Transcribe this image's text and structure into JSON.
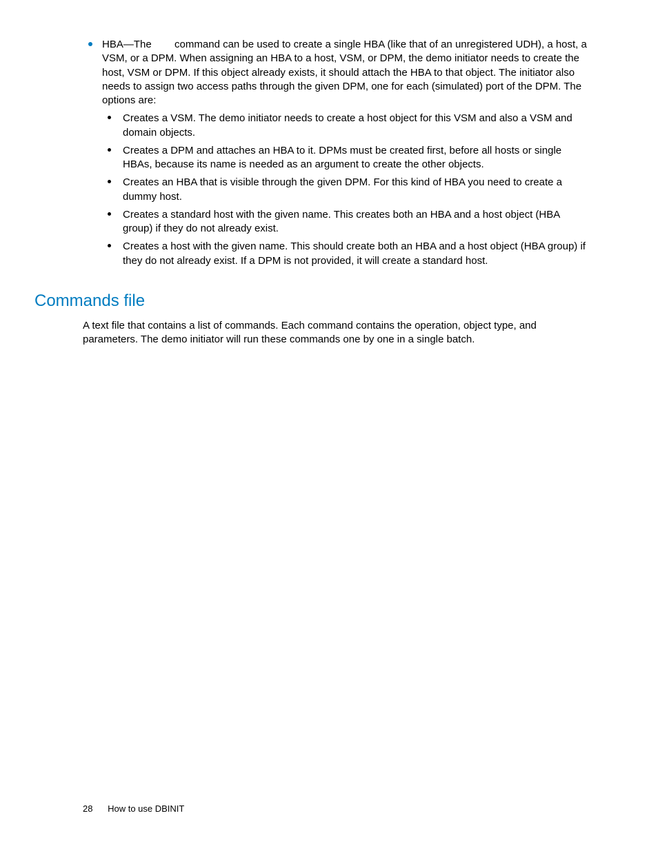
{
  "content": {
    "hba": {
      "prefix": "HBA—The",
      "intro": "command can be used to create a single HBA (like that of an unregistered UDH), a host, a VSM, or a DPM. When assigning an HBA to a host, VSM, or DPM, the demo initiator needs to create the host, VSM or DPM. If this object already exists, it should attach the HBA to that object. The initiator also needs to assign two access paths through the given DPM, one for each (simulated) port of the DPM. The options are:",
      "options": [
        "Creates a VSM. The demo initiator needs to create a host object for this VSM and also a VSM and domain objects.",
        "Creates a DPM and attaches an HBA to it. DPMs must be created first, before all hosts or single HBAs, because its name is needed as an argument to create the other objects.",
        "Creates an HBA that is visible through the given DPM. For this kind of HBA you need to create a dummy host.",
        "Creates a standard host with the given name. This creates both an HBA and a host object (HBA group) if they do not already exist.",
        "Creates a host with the given name. This should create both an HBA and a host object (HBA group) if they do not already exist. If a DPM is not provided, it will create a standard host."
      ]
    },
    "commandsFile": {
      "heading": "Commands file",
      "body": "A text file that contains a list of commands. Each command contains the operation, object type, and parameters. The demo initiator will run these commands one by one in a single batch."
    }
  },
  "footer": {
    "pageNumber": "28",
    "chapter": "How to use DBINIT"
  }
}
